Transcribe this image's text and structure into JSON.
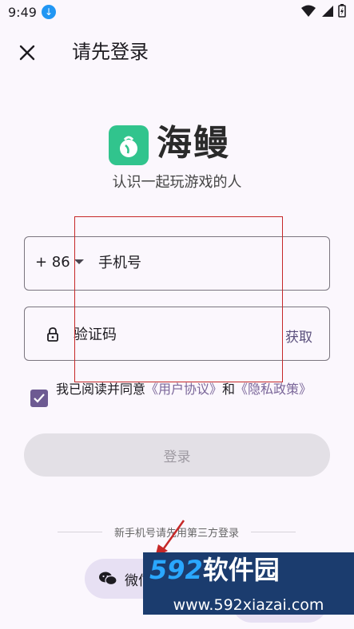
{
  "status_bar": {
    "time": "9:49"
  },
  "header": {
    "title": "请先登录"
  },
  "brand": {
    "name": "海鳗",
    "slogan": "认识一起玩游戏的人"
  },
  "phone": {
    "country_code": "+ 86",
    "placeholder": "手机号"
  },
  "code": {
    "placeholder": "验证码",
    "get_code_label": "获取"
  },
  "agreement": {
    "checked": true,
    "prefix": "我已阅读并同意",
    "user_agreement": "《用户协议》",
    "and": "和",
    "privacy_policy": "《隐私政策》"
  },
  "login": {
    "label": "登录"
  },
  "third_party": {
    "hint": "新手机号请先用第三方登录",
    "wechat_label": "微信"
  },
  "watermark": {
    "brand_number": "592",
    "brand_text": "软件园",
    "url": "www.592xiazai.com"
  },
  "colors": {
    "accent": "#6d5a92",
    "annotation": "#c62828",
    "logo": "#31c48d"
  }
}
